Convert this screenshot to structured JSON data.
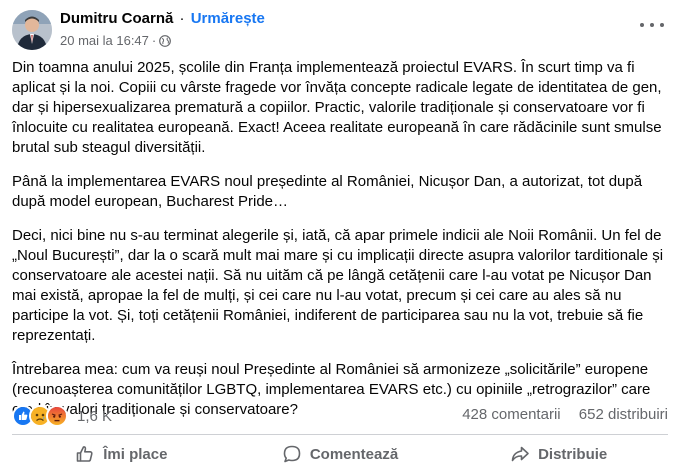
{
  "author": {
    "name": "Dumitru Coarnă",
    "separator": "·",
    "follow_label": "Urmărește"
  },
  "meta": {
    "date": "20 mai la 16:47",
    "separator": "·",
    "audience_icon": "globe-icon"
  },
  "post": {
    "paragraphs": [
      "Din toamna anului 2025, școlile din Franța implementează proiectul EVARS. În scurt timp va fi aplicat și la noi. Copiii cu vârste fragede vor învăța concepte radicale legate de identitatea de gen, dar și hipersexualizarea prematură a copiilor. Practic, valorile tradiționale și conservatoare vor fi înlocuite cu realitatea europeană. Exact! Aceea realitate europeană în care rădăcinile sunt smulse brutal sub steagul diversității.",
      "Până la implementarea EVARS noul președinte al României, Nicușor Dan, a autorizat, tot după după model european, Bucharest Pride…",
      "Deci, nici bine nu s-au terminat alegerile și, iată, că apar primele indicii ale Noii Românii. Un fel de „Noul București”, dar la o scară mult mai mare și cu implicații directe asupra valorilor tarditionale și conservatoare ale acestei nații. Să nu uităm că pe lângă cetățenii care l-au votat pe Nicușor Dan mai există, apropae la fel de mulți, și cei care nu l-au votat, precum și cei care au ales să nu participe la vot. Și, toți cetățenii României, indiferent de participarea sau nu la vot, trebuie să fie reprezentați.",
      "Întrebarea mea: cum va reuși noul Președinte al României să armonizeze „solicitările” europene (recunoașterea comunităților LGBTQ, implementarea EVARS etc.) cu opiniile „retrograzilor” care cred în valori tradiționale și conservatoare?"
    ]
  },
  "stats": {
    "reaction_icons": [
      "like-icon",
      "sad-icon",
      "angry-icon"
    ],
    "reaction_count": "1,6 K",
    "comments": "428 comentarii",
    "shares": "652 distribuiri"
  },
  "actions": {
    "like_label": "Îmi place",
    "comment_label": "Comentează",
    "share_label": "Distribuie"
  },
  "colors": {
    "accent": "#1877f2",
    "secondary_text": "#65676b",
    "primary_text": "#050505",
    "divider": "#ced0d4"
  }
}
